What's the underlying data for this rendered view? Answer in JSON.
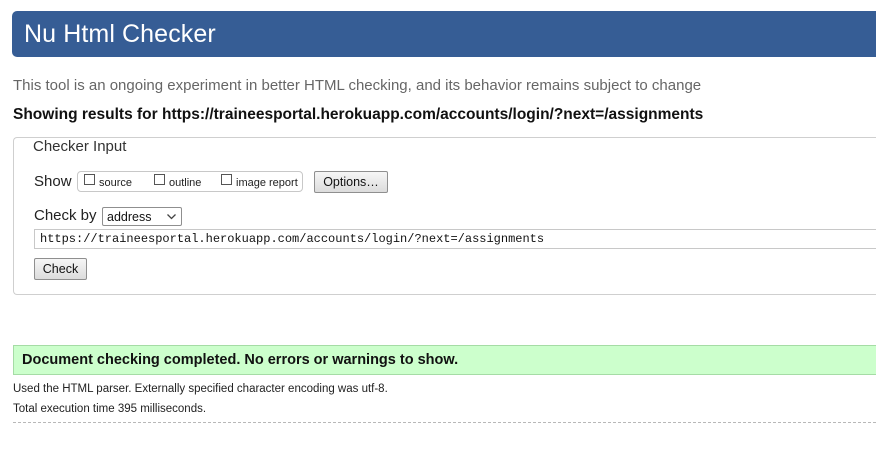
{
  "header": {
    "title": "Nu Html Checker"
  },
  "tagline": "This tool is an ongoing experiment in better HTML checking, and its behavior remains subject to change",
  "showing_results": "Showing results for https://traineesportal.herokuapp.com/accounts/login/?next=/assignments",
  "checker_input": {
    "legend": "Checker Input",
    "show_label": "Show",
    "options": [
      {
        "label": "source",
        "checked": false
      },
      {
        "label": "outline",
        "checked": false
      },
      {
        "label": "image report",
        "checked": false
      }
    ],
    "options_button": "Options…",
    "check_by_label": "Check by",
    "check_by_value": "address",
    "url_value": "https://traineesportal.herokuapp.com/accounts/login/?next=/assignments",
    "check_button": "Check"
  },
  "result": {
    "message": "Document checking completed. No errors or warnings to show.",
    "status_color": "#ccffcc"
  },
  "details": {
    "parser_line": "Used the HTML parser. Externally specified character encoding was utf-8.",
    "time_line": "Total execution time 395 milliseconds."
  },
  "colors": {
    "header_bg": "#365d95",
    "success_bg": "#ccffcc"
  }
}
